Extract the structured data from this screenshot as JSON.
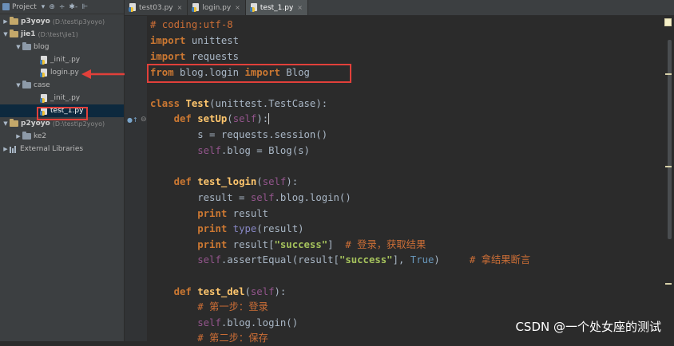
{
  "project_panel": {
    "title": "Project",
    "toolbar_buttons": [
      "⊕",
      "÷",
      "✱-",
      "⊩"
    ],
    "tree": [
      {
        "name": "p3yoyo",
        "path": "(D:\\test\\p3yoyo)"
      },
      {
        "name": "jie1",
        "path": "(D:\\test\\jie1)"
      },
      {
        "name": "blog"
      },
      {
        "name": "_init_.py"
      },
      {
        "name": "login.py"
      },
      {
        "name": "case"
      },
      {
        "name": "_init_.py"
      },
      {
        "name": "test_1.py"
      },
      {
        "name": "p2yoyo",
        "path": "(D:\\test\\p2yoyo)"
      },
      {
        "name": "ke2"
      },
      {
        "name": "External Libraries"
      }
    ]
  },
  "tabs": [
    {
      "label": "test03.py",
      "close": "×"
    },
    {
      "label": "login.py",
      "close": "×"
    },
    {
      "label": "test_1.py",
      "close": "×"
    }
  ],
  "code": {
    "l1": "# coding:utf-8",
    "import": "import",
    "unittest": " unittest",
    "requests": " requests",
    "from": "from",
    "blog_login": " blog.login ",
    "Blog": " Blog",
    "class": "class",
    "Test": "Test",
    "test_parent": "(unittest.TestCase):",
    "def": "def",
    "setUp": "setUp",
    "self_kw": "self",
    "sig_close": "):",
    "open_paren": "(",
    "s_session": "s = requests.session()",
    "self_blog": ".blog = Blog(s)",
    "test_login": "test_login",
    "result_eq": "result = ",
    "blog_login_call": ".blog.login()",
    "print": "print",
    "result": " result",
    "type": " type",
    "type_arg": "(result)",
    "result_open": " result[",
    "success": "\"success\"",
    "bracket_close": "]",
    "comment_login": "# 登录，获取结果",
    "assert": ".assertEqual(result[",
    "assert_mid": "], ",
    "True": "True",
    "paren_close": ")",
    "comment_assert": "# 拿结果断言",
    "test_del": "test_del",
    "step1": "# 第一步：登录",
    "blog_login_call2": ".blog.login()",
    "step2": "# 第二步：保存"
  },
  "watermark": "CSDN @一个处女座的测试"
}
